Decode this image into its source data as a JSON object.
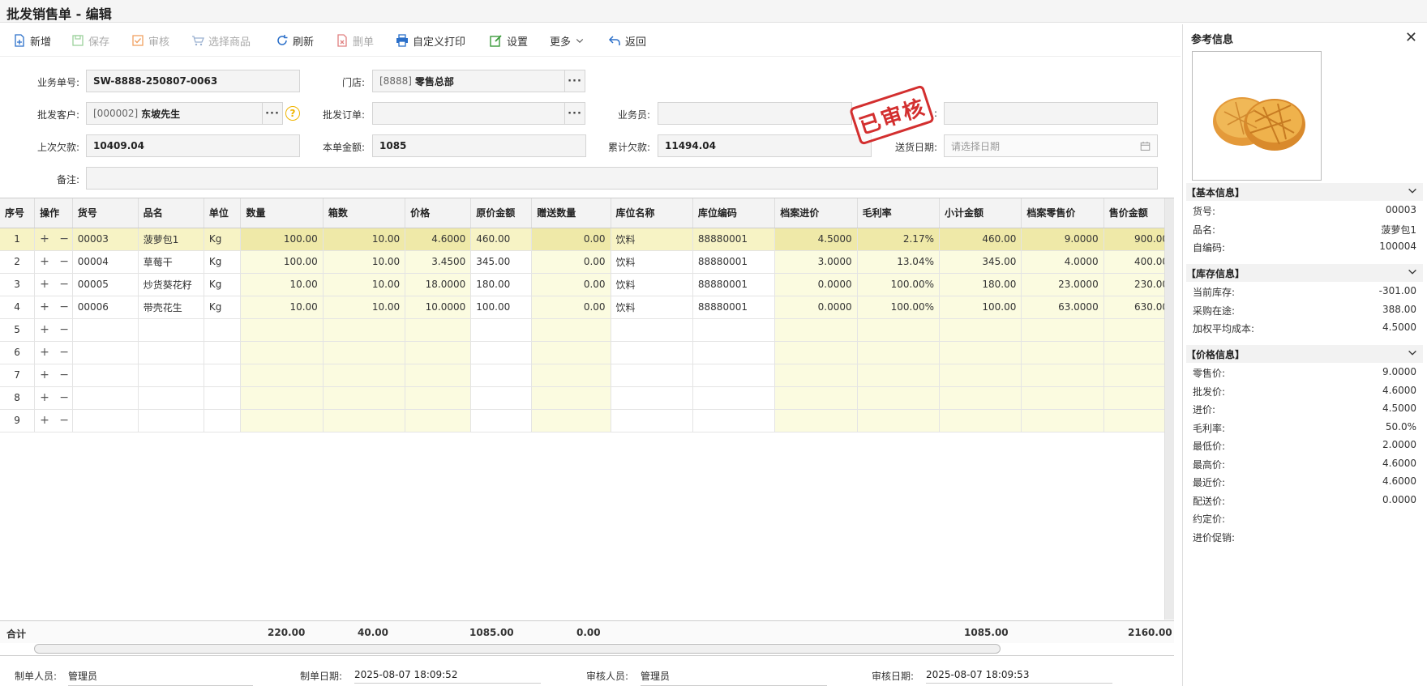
{
  "window": {
    "title": "批发销售单 - 编辑"
  },
  "toolbar": {
    "new": "新增",
    "save": "保存",
    "audit": "审核",
    "select_goods": "选择商品",
    "refresh": "刷新",
    "delete": "删单",
    "custom_print": "自定义打印",
    "settings": "设置",
    "more": "更多",
    "back": "返回"
  },
  "form": {
    "doc_no_label": "业务单号:",
    "doc_no": "SW-8888-250807-0063",
    "store_label": "门店:",
    "store_code": "[8888]",
    "store_name": "零售总部",
    "customer_label": "批发客户:",
    "customer_code": "[000002]",
    "customer_name": "东坡先生",
    "order_label": "批发订单:",
    "order_value": "",
    "salesman_label": "业务员:",
    "salesman_value": "",
    "extra_label": ":",
    "extra_value": "",
    "last_debt_label": "上次欠款:",
    "last_debt": "10409.04",
    "amount_label": "本单金额:",
    "amount": "1085",
    "total_debt_label": "累计欠款:",
    "total_debt": "11494.04",
    "delivery_label": "送货日期:",
    "delivery_placeholder": "请选择日期",
    "remark_label": "备注:",
    "remark": "",
    "stamp": "已审核"
  },
  "grid": {
    "columns": [
      "序号",
      "操作",
      "货号",
      "品名",
      "单位",
      "数量",
      "箱数",
      "价格",
      "原价金额",
      "赠送数量",
      "库位名称",
      "库位编码",
      "档案进价",
      "毛利率",
      "小计金额",
      "档案零售价",
      "售价金额"
    ],
    "rows": [
      {
        "seq": "1",
        "code": "00003",
        "name": "菠萝包1",
        "unit": "Kg",
        "qty": "100.00",
        "boxes": "10.00",
        "price": "4.6000",
        "orig_amt": "460.00",
        "gift": "0.00",
        "loc_name": "饮料",
        "loc_code": "88880001",
        "cost": "4.5000",
        "margin": "2.17%",
        "subtotal": "460.00",
        "retail": "9.0000",
        "sale_amt": "900.00"
      },
      {
        "seq": "2",
        "code": "00004",
        "name": "草莓干",
        "unit": "Kg",
        "qty": "100.00",
        "boxes": "10.00",
        "price": "3.4500",
        "orig_amt": "345.00",
        "gift": "0.00",
        "loc_name": "饮料",
        "loc_code": "88880001",
        "cost": "3.0000",
        "margin": "13.04%",
        "subtotal": "345.00",
        "retail": "4.0000",
        "sale_amt": "400.00"
      },
      {
        "seq": "3",
        "code": "00005",
        "name": "炒货葵花籽",
        "unit": "Kg",
        "qty": "10.00",
        "boxes": "10.00",
        "price": "18.0000",
        "orig_amt": "180.00",
        "gift": "0.00",
        "loc_name": "饮料",
        "loc_code": "88880001",
        "cost": "0.0000",
        "margin": "100.00%",
        "subtotal": "180.00",
        "retail": "23.0000",
        "sale_amt": "230.00"
      },
      {
        "seq": "4",
        "code": "00006",
        "name": "带壳花生",
        "unit": "Kg",
        "qty": "10.00",
        "boxes": "10.00",
        "price": "10.0000",
        "orig_amt": "100.00",
        "gift": "0.00",
        "loc_name": "饮料",
        "loc_code": "88880001",
        "cost": "0.0000",
        "margin": "100.00%",
        "subtotal": "100.00",
        "retail": "63.0000",
        "sale_amt": "630.00"
      }
    ],
    "empty_rows": [
      "5",
      "6",
      "7",
      "8",
      "9"
    ],
    "ops_label": "+ −",
    "totals": {
      "label": "合计",
      "qty": "220.00",
      "boxes": "40.00",
      "orig_amt": "1085.00",
      "gift": "0.00",
      "subtotal": "1085.00",
      "sale_amt": "2160.00"
    }
  },
  "footer": {
    "maker_label": "制单人员:",
    "maker": "管理员",
    "make_date_label": "制单日期:",
    "make_date": "2025-08-07 18:09:52",
    "auditor_label": "审核人员:",
    "auditor": "管理员",
    "audit_date_label": "审核日期:",
    "audit_date": "2025-08-07 18:09:53"
  },
  "side": {
    "title": "参考信息",
    "basic": {
      "title": "【基本信息】",
      "items": [
        {
          "k": "货号:",
          "v": "00003"
        },
        {
          "k": "品名:",
          "v": "菠萝包1"
        },
        {
          "k": "自编码:",
          "v": "100004"
        }
      ]
    },
    "stock": {
      "title": "【库存信息】",
      "items": [
        {
          "k": "当前库存:",
          "v": "-301.00"
        },
        {
          "k": "采购在途:",
          "v": "388.00"
        },
        {
          "k": "加权平均成本:",
          "v": "4.5000"
        }
      ]
    },
    "price": {
      "title": "【价格信息】",
      "items": [
        {
          "k": "零售价:",
          "v": "9.0000"
        },
        {
          "k": "批发价:",
          "v": "4.6000"
        },
        {
          "k": "进价:",
          "v": "4.5000"
        },
        {
          "k": "毛利率:",
          "v": "50.0%"
        },
        {
          "k": "最低价:",
          "v": "2.0000"
        },
        {
          "k": "最高价:",
          "v": "4.6000"
        },
        {
          "k": "最近价:",
          "v": "4.6000"
        },
        {
          "k": "配送价:",
          "v": "0.0000"
        },
        {
          "k": "约定价:",
          "v": ""
        },
        {
          "k": "进价促销:",
          "v": ""
        }
      ]
    }
  }
}
